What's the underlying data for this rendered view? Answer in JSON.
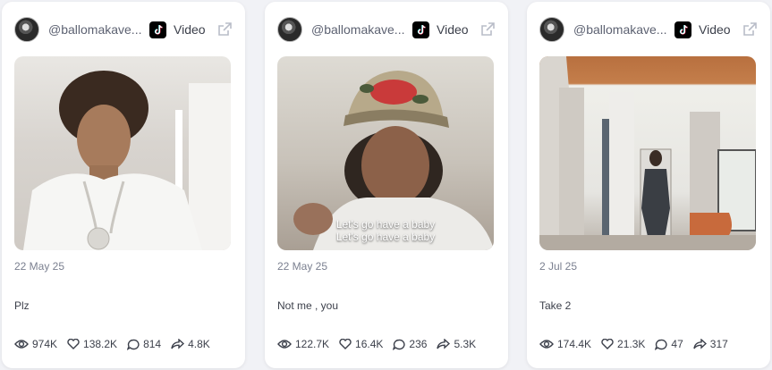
{
  "cards": [
    {
      "username": "@ballomakave...",
      "platform": "Video",
      "date": "22 May 25",
      "caption": "Plz",
      "subtitle": [
        "",
        ""
      ],
      "views": "974K",
      "likes": "138.2K",
      "comments": "814",
      "shares": "4.8K"
    },
    {
      "username": "@ballomakave...",
      "platform": "Video",
      "date": "22 May 25",
      "caption": "Not me , you",
      "subtitle": [
        "Let's go have a baby",
        "Let's go have a baby"
      ],
      "views": "122.7K",
      "likes": "16.4K",
      "comments": "236",
      "shares": "5.3K"
    },
    {
      "username": "@ballomakave...",
      "platform": "Video",
      "date": "2 Jul 25",
      "caption": "Take 2",
      "subtitle": [
        "",
        ""
      ],
      "views": "174.4K",
      "likes": "21.3K",
      "comments": "47",
      "shares": "317"
    }
  ],
  "icons": [
    "avatar",
    "tiktok-icon",
    "external-link-icon",
    "eye-icon",
    "heart-icon",
    "comment-icon",
    "share-icon"
  ]
}
